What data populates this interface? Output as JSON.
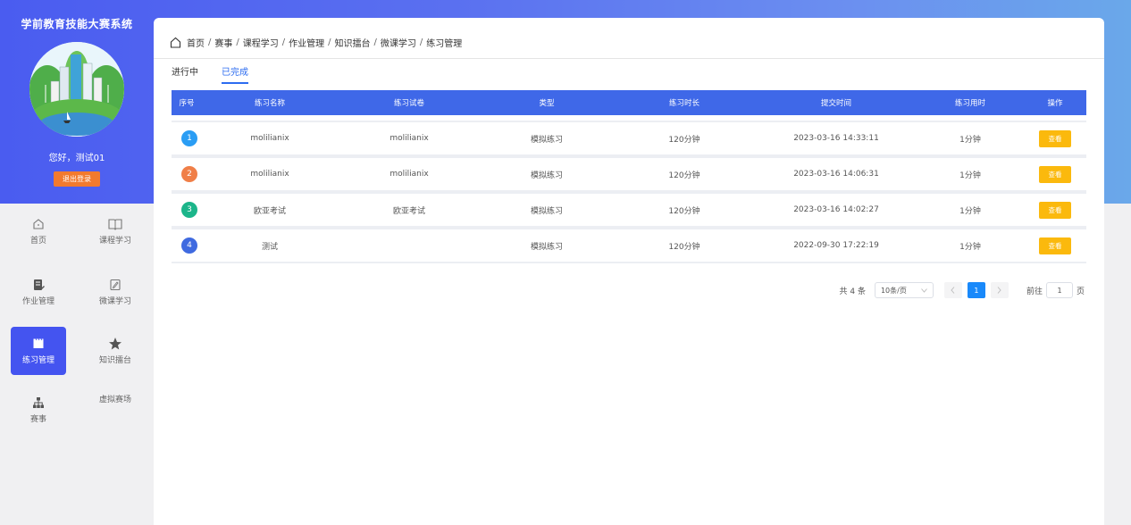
{
  "app": {
    "title": "学前教育技能大赛系统",
    "greeting": "您好，测试01",
    "logout_label": "退出登录"
  },
  "nav": {
    "home": "首页",
    "course": "课程学习",
    "homework": "作业管理",
    "microcourse": "微课学习",
    "practice": "练习管理",
    "knowledge": "知识擂台",
    "contest": "赛事",
    "virtual": "虚拟赛场",
    "active": "练习管理"
  },
  "breadcrumb": {
    "items": [
      "首页",
      "赛事",
      "课程学习",
      "作业管理",
      "知识擂台",
      "微课学习",
      "练习管理"
    ]
  },
  "tabs": {
    "ongoing": "进行中",
    "completed": "已完成",
    "active": "已完成"
  },
  "table": {
    "headers": [
      "序号",
      "练习名称",
      "练习试卷",
      "类型",
      "练习时长",
      "提交时间",
      "练习用时",
      "操作"
    ],
    "rows": [
      {
        "idx": "1",
        "name": "molilianix",
        "paper": "molilianix",
        "type": "模拟练习",
        "duration": "120分钟",
        "submitted": "2023-03-16 14:33:11",
        "used": "1分钟",
        "action": "查看",
        "color": "#2a9df4"
      },
      {
        "idx": "2",
        "name": "molilianix",
        "paper": "molilianix",
        "type": "模拟练习",
        "duration": "120分钟",
        "submitted": "2023-03-16 14:06:31",
        "used": "1分钟",
        "action": "查看",
        "color": "#f07f48"
      },
      {
        "idx": "3",
        "name": "欧亚考试",
        "paper": "欧亚考试",
        "type": "模拟练习",
        "duration": "120分钟",
        "submitted": "2023-03-16 14:02:27",
        "used": "1分钟",
        "action": "查看",
        "color": "#1cb58a"
      },
      {
        "idx": "4",
        "name": "测试",
        "paper": "",
        "type": "模拟练习",
        "duration": "120分钟",
        "submitted": "2022-09-30 17:22:19",
        "used": "1分钟",
        "action": "查看",
        "color": "#3f6ae0"
      }
    ]
  },
  "pager": {
    "total": "共 4 条",
    "page_size": "10条/页",
    "current_page": "1",
    "goto_label": "前往",
    "goto_value": "1",
    "page_unit": "页"
  }
}
